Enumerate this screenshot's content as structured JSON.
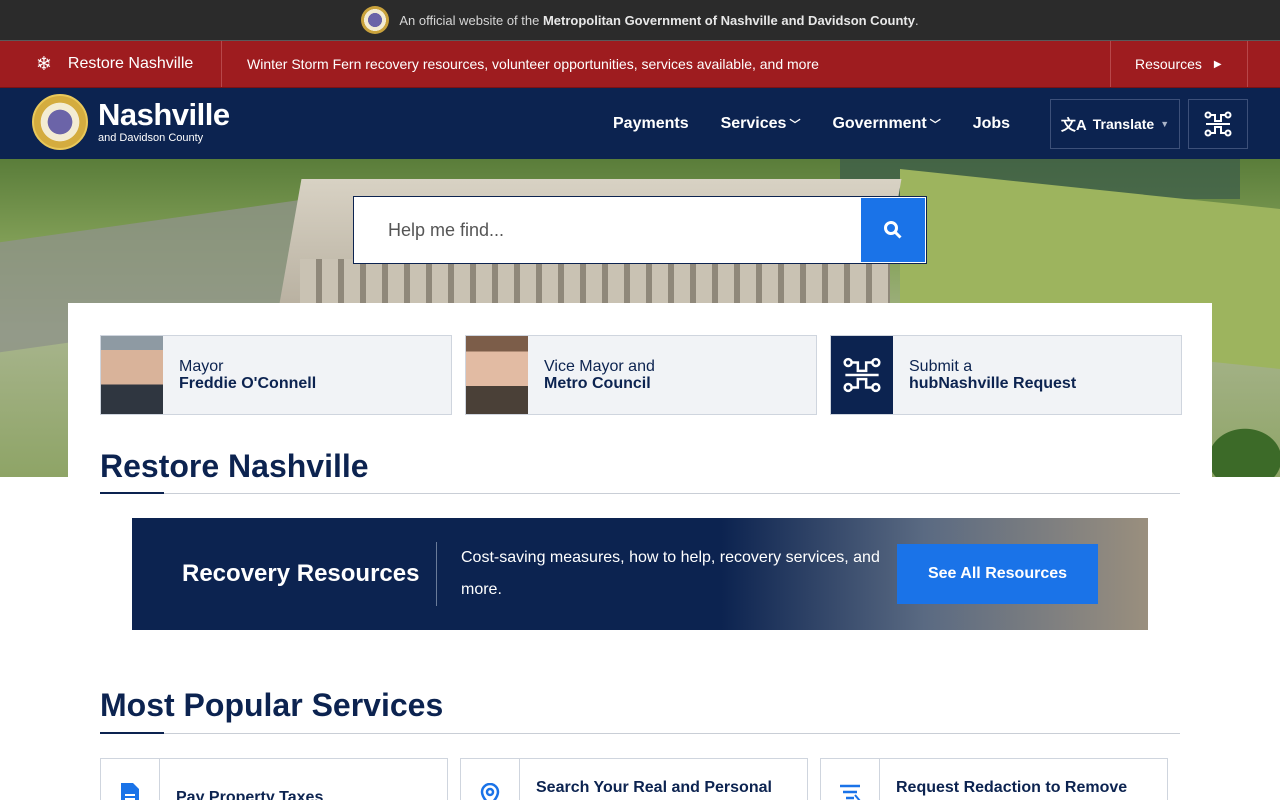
{
  "official_banner": {
    "prefix": "An official website of the",
    "org": "Metropolitan Government of Nashville and Davidson County",
    "suffix": "."
  },
  "alert": {
    "icon": "snowflake-icon",
    "title": "Restore Nashville",
    "message": "Winter Storm Fern recovery resources, volunteer opportunities, services available, and more",
    "link": "Resources"
  },
  "header": {
    "logo_title": "Nashville",
    "logo_subtitle": "and Davidson County",
    "nav": [
      "Payments",
      "Services",
      "Government",
      "Jobs"
    ],
    "translate": "Translate"
  },
  "search": {
    "placeholder": "Help me find..."
  },
  "quick_links": [
    {
      "line1": "Mayor",
      "line2": "Freddie O'Connell"
    },
    {
      "line1": "Vice Mayor and",
      "line2": "Metro Council"
    },
    {
      "line1": "Submit a",
      "line2": "hubNashville Request"
    }
  ],
  "restore_section": {
    "title": "Restore Nashville",
    "banner_title": "Recovery Resources",
    "banner_desc": "Cost-saving measures, how to help, recovery services, and more.",
    "banner_button": "See All Resources"
  },
  "popular_section": {
    "title": "Most Popular Services",
    "items": [
      "Pay Property Taxes",
      "Search Your Real and Personal",
      "Request Redaction to Remove"
    ]
  },
  "colors": {
    "navy": "#0c2350",
    "alert_red": "#9e1c1f",
    "accent_blue": "#1a73e8"
  }
}
